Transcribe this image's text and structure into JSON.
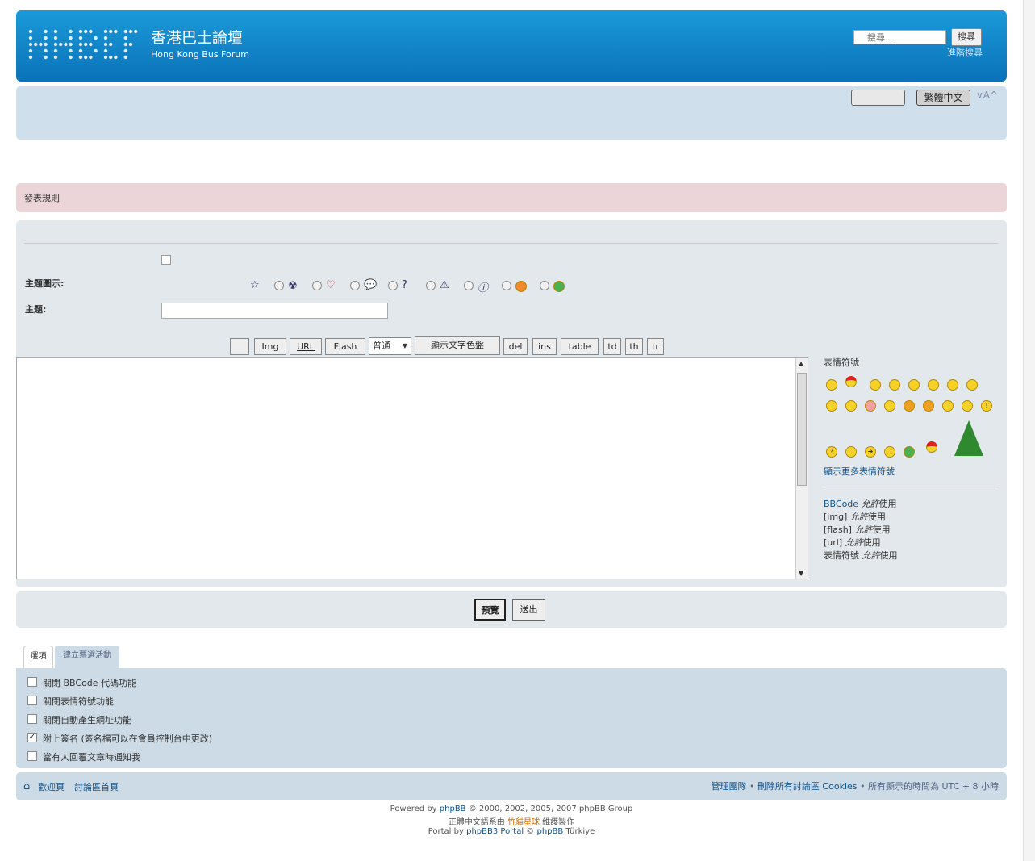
{
  "header": {
    "site_title": "香港巴士論壇",
    "site_sub": "Hong Kong Bus Forum",
    "search_placeholder": "搜尋...",
    "search_button": "搜尋",
    "advanced_search": "進階搜尋"
  },
  "navbar": {
    "lang_button": "繁體中文",
    "font_size": "∨A^"
  },
  "rules_label": "發表規則",
  "icon_label": "主題圖示:",
  "subject_label": "主題:",
  "toolbar": {
    "buttons": [
      "Img",
      "URL",
      "Flash",
      "普通",
      "顯示文字色盤",
      "del",
      "ins",
      "table",
      "td",
      "th",
      "tr"
    ]
  },
  "sidebar": {
    "smilies_title": "表情符號",
    "more_smilies": "顯示更多表情符號",
    "rules": [
      {
        "code": "BBCode",
        "state": "允許",
        "suffix": "使用"
      },
      {
        "code": "[img]",
        "state": "允許",
        "suffix": "使用"
      },
      {
        "code": "[flash]",
        "state": "允許",
        "suffix": "使用"
      },
      {
        "code": "[url]",
        "state": "允許",
        "suffix": "使用"
      },
      {
        "code": "表情符號",
        "state": "允許",
        "suffix": "使用"
      }
    ]
  },
  "submit": {
    "preview": "預覽",
    "send": "送出"
  },
  "tabs": {
    "options": "選項",
    "poll": "建立票選活動"
  },
  "options": [
    {
      "label": "關閉 BBCode 代碼功能",
      "checked": false
    },
    {
      "label": "關閉表情符號功能",
      "checked": false
    },
    {
      "label": "關閉自動產生網址功能",
      "checked": false
    },
    {
      "label": "附上簽名 (簽名檔可以在會員控制台中更改)",
      "checked": true
    },
    {
      "label": "當有人回覆文章時通知我",
      "checked": false
    }
  ],
  "footer": {
    "welcome": "歡迎頁",
    "index": "討論區首頁",
    "team": "管理團隊",
    "delete_cookies": "刪除所有討論區 Cookies",
    "timezone": "所有顯示的時間為 UTC + 8 小時",
    "sep": " • "
  },
  "copyright": {
    "line1_a": "Powered by ",
    "line1_link": "phpBB",
    "line1_b": " © 2000, 2002, 2005, 2007 phpBB Group",
    "line2_a": "正體中文語系由 ",
    "line2_link": "竹貓星球",
    "line2_b": " 維護製作",
    "line3_a": "Portal by ",
    "line3_link1": "phpBB3 Portal",
    "line3_mid": " © ",
    "line3_link2": "phpBB",
    "line3_b": " Türkiye"
  }
}
